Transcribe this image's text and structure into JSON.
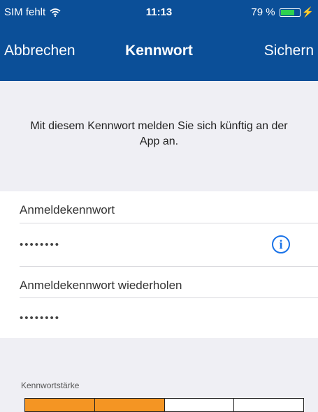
{
  "status_bar": {
    "carrier": "SIM fehlt",
    "time": "11:13",
    "battery_text": "79 %",
    "battery_level": 0.79
  },
  "nav": {
    "cancel_label": "Abbrechen",
    "title": "Kennwort",
    "save_label": "Sichern"
  },
  "info": {
    "text": "Mit diesem Kennwort melden Sie sich künftig an der App an."
  },
  "password_field": {
    "label": "Anmeldekennwort",
    "value": "••••••••"
  },
  "repeat_field": {
    "label": "Anmeldekennwort wiederholen",
    "value": "••••••••"
  },
  "strength": {
    "label": "Kennwortstärke",
    "segments_total": 4,
    "segments_filled": 2,
    "fill_color": "#f49523"
  },
  "colors": {
    "nav_background": "#0b4f98",
    "accent": "#1a73e8"
  }
}
